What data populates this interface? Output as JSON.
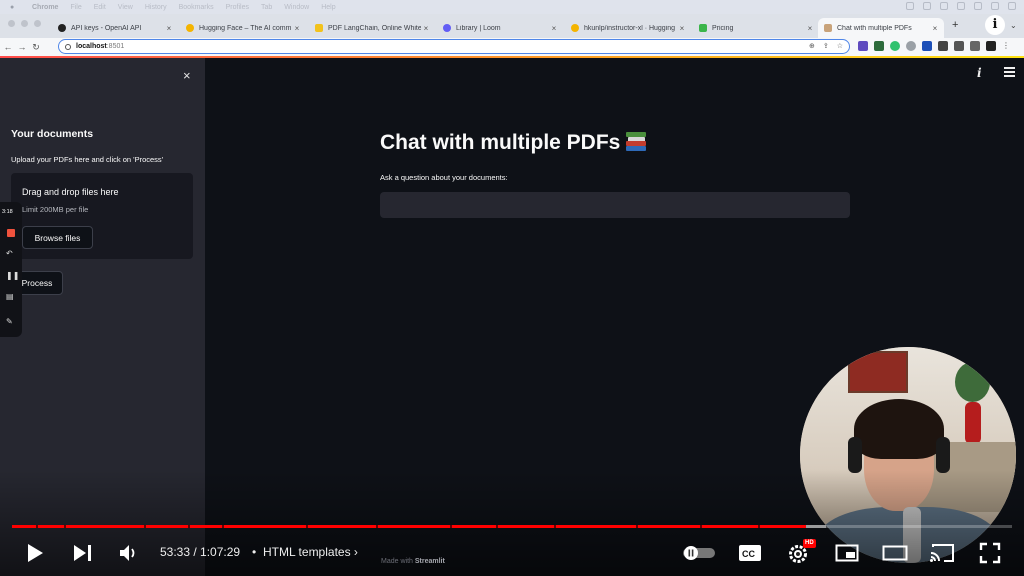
{
  "menubar": {
    "items": [
      "Chrome",
      "File",
      "Edit",
      "View",
      "History",
      "Bookmarks",
      "Profiles",
      "Tab",
      "Window",
      "Help"
    ]
  },
  "browser": {
    "tabs": [
      {
        "label": "API keys - OpenAI API",
        "favicon_color": "#222222"
      },
      {
        "label": "Hugging Face – The AI comm",
        "favicon_color": "#f4b400"
      },
      {
        "label": "PDF LangChain, Online Whitel",
        "favicon_color": "#f2c21b"
      },
      {
        "label": "Library | Loom",
        "favicon_color": "#625df5"
      },
      {
        "label": "hkunlp/instructor-xl · Hugging",
        "favicon_color": "#f4b400"
      },
      {
        "label": "Pricing",
        "favicon_color": "#3bb54a"
      },
      {
        "label": "Chat with multiple PDFs",
        "favicon_color": "#c9a37a",
        "active": true
      }
    ],
    "new_tab": "+",
    "profile_initial": "i",
    "address": {
      "host": "localhost",
      "port": ":8501"
    }
  },
  "sidebar": {
    "close_icon": "×",
    "heading": "Your documents",
    "hint": "Upload your PDFs here and click on 'Process'",
    "dropzone_title": "Drag and drop files here",
    "dropzone_limit": "Limit 200MB per file",
    "browse_label": "Browse files",
    "process_label": "Process"
  },
  "loom": {
    "timer": "3:18"
  },
  "main": {
    "title": "Chat with multiple PDFs",
    "question_label": "Ask a question about your documents:",
    "question_value": "",
    "footer_prefix": "Made with",
    "footer_brand": "Streamlit"
  },
  "player": {
    "current_time": "53:33",
    "separator": " / ",
    "duration": "1:07:29",
    "chapter": "HTML templates",
    "hd_badge": "HD",
    "played_fraction": 0.7936,
    "buffered_fraction": 0.814,
    "accent_color": "#ff0000"
  }
}
